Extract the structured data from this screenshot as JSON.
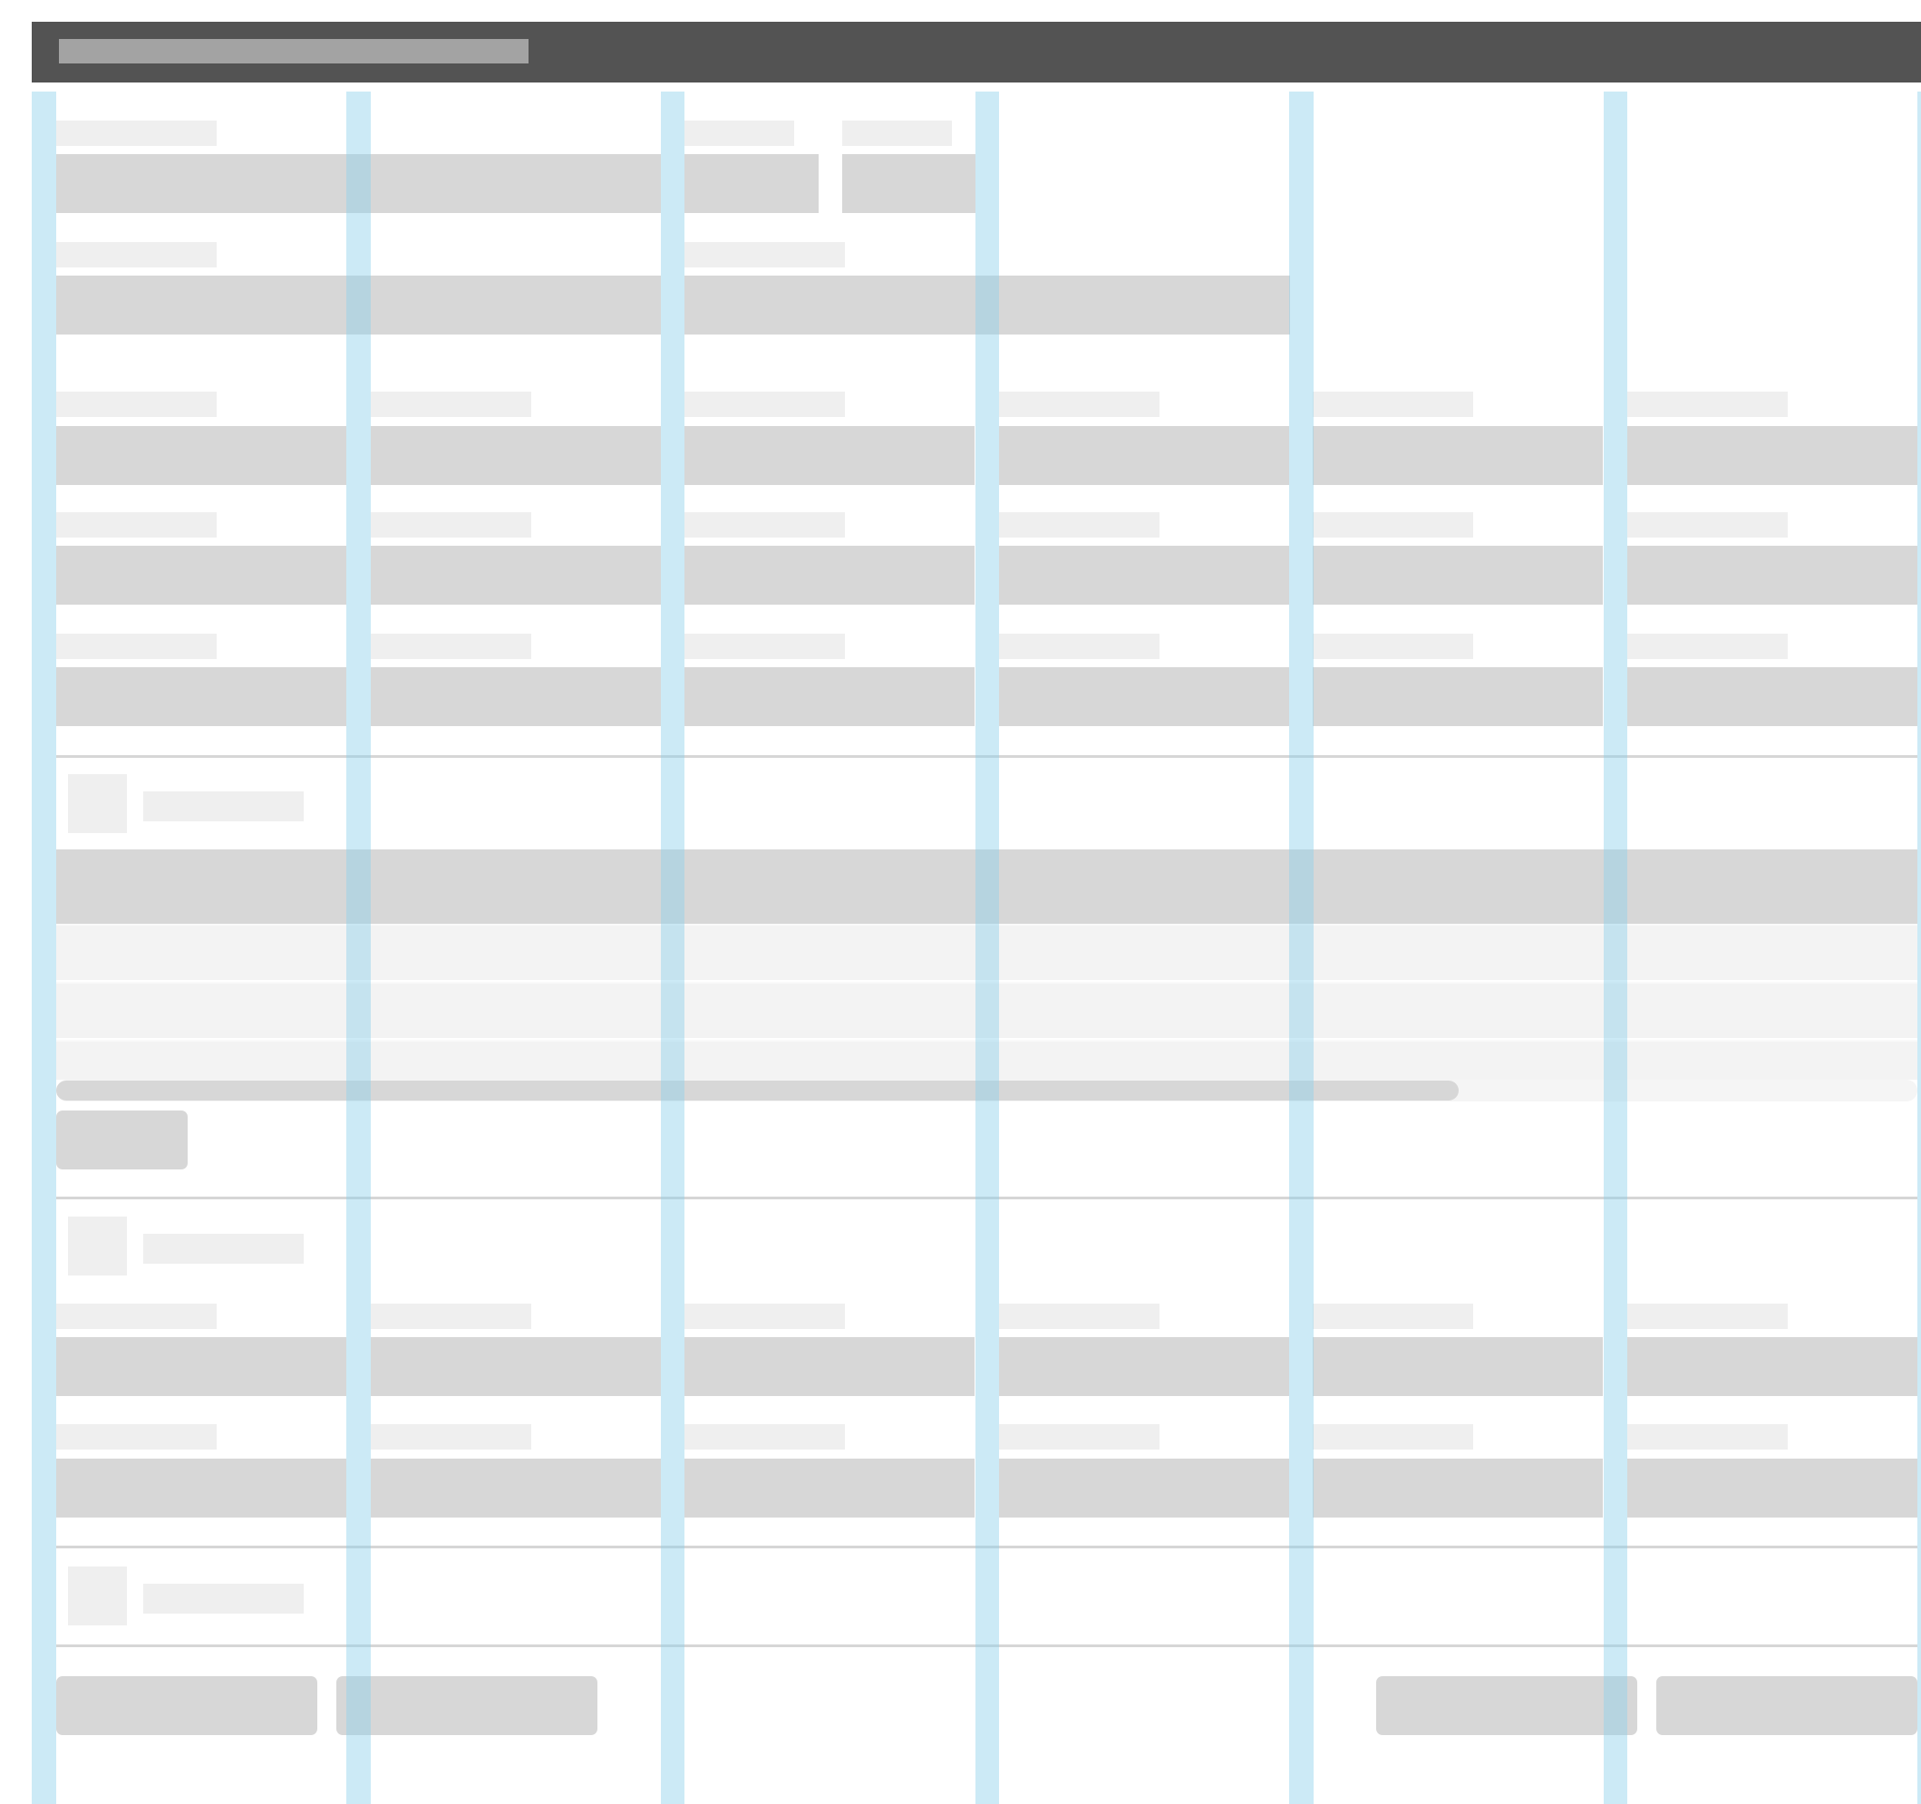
{
  "window": {
    "title": ""
  },
  "colors": {
    "titlebar": "#535353",
    "grid_guide": "#8fd0ea",
    "field": "#d7d7d7",
    "label_placeholder": "#efefef"
  },
  "form": {
    "row1": {
      "labels": [
        "",
        "",
        ""
      ]
    },
    "row2": {
      "labels": [
        "",
        ""
      ]
    },
    "row3": {
      "labels": [
        "",
        "",
        "",
        "",
        "",
        ""
      ]
    },
    "row4": {
      "labels": [
        "",
        "",
        "",
        "",
        "",
        ""
      ]
    },
    "row5": {
      "labels": [
        "",
        "",
        "",
        "",
        "",
        ""
      ]
    }
  },
  "sections": [
    {
      "title": "",
      "icon": "section-icon"
    },
    {
      "title": "",
      "icon": "section-icon"
    },
    {
      "title": "",
      "icon": "section-icon"
    }
  ],
  "table": {
    "rows": [
      "",
      "",
      ""
    ],
    "add_button": ""
  },
  "section2": {
    "row1": {
      "labels": [
        "",
        "",
        "",
        "",
        "",
        ""
      ]
    },
    "row2": {
      "labels": [
        "",
        "",
        "",
        "",
        "",
        ""
      ]
    }
  },
  "footer": {
    "left_buttons": [
      "",
      ""
    ],
    "right_buttons": [
      "",
      ""
    ]
  }
}
